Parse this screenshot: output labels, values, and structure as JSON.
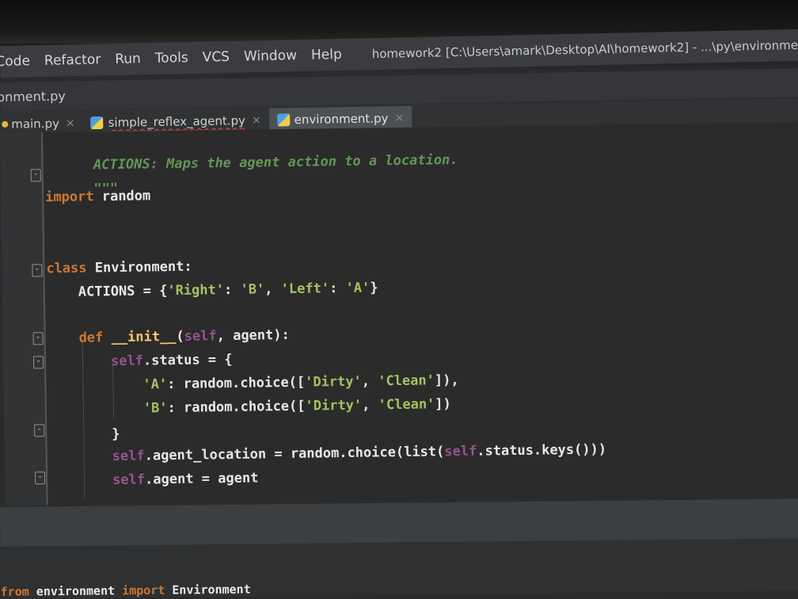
{
  "menu": {
    "items": [
      "Code",
      "Refactor",
      "Run",
      "Tools",
      "VCS",
      "Window",
      "Help"
    ],
    "window_title": "homework2 [C:\\Users\\amark\\Desktop\\AI\\homework2] - ...\\py\\environment.p"
  },
  "breadcrumb": {
    "file": "onment.py"
  },
  "tabs": [
    {
      "label": "main.py",
      "close": "×"
    },
    {
      "label": "simple_reflex_agent.py",
      "close": "×"
    },
    {
      "label": "environment.py",
      "close": "×",
      "active": true
    }
  ],
  "code": {
    "l1_doc": "ACTIONS: Maps the agent action to a location.",
    "l2_doc_end": "\"\"\"",
    "l3_kw": "import",
    "l3_mod": " random",
    "l4_kw": "class",
    "l4_name": " Environment:",
    "l5_pre": "ACTIONS = {",
    "l5_s1": "'Right'",
    "l5_m1": ": ",
    "l5_s2": "'B'",
    "l5_m2": ", ",
    "l5_s3": "'Left'",
    "l5_m3": ": ",
    "l5_s4": "'A'",
    "l5_post": "}",
    "l6_kw": "def",
    "l6_fn": "__init__",
    "l6_p1": "(",
    "l6_self": "self",
    "l6_p2": ", agent):",
    "l7_self": "self",
    "l7_rest": ".status = {",
    "l8_key": "'A'",
    "l8_mid": ": random.choice([",
    "l8_s1": "'Dirty'",
    "l8_c": ", ",
    "l8_s2": "'Clean'",
    "l8_end": "]),",
    "l9_key": "'B'",
    "l9_mid": ": random.choice([",
    "l9_s1": "'Dirty'",
    "l9_c": ", ",
    "l9_s2": "'Clean'",
    "l9_end": "])",
    "l10": "}",
    "l11_self": "self",
    "l11_mid": ".agent_location = random.choice(list(",
    "l11_self2": "self",
    "l11_end": ".status.keys()))",
    "l12_self": "self",
    "l12_rest": ".agent = agent"
  },
  "bottom": {
    "kw": "from",
    "mid": " environment ",
    "kw2": "import",
    "name": " Environment"
  }
}
